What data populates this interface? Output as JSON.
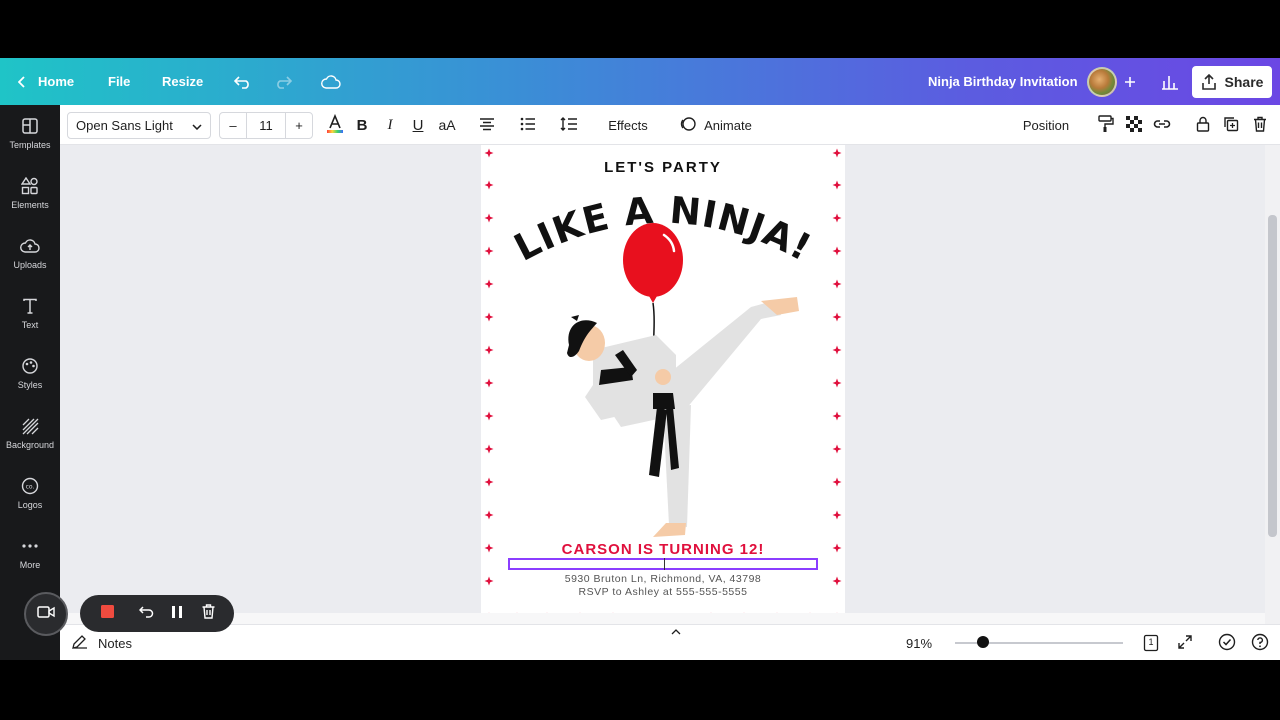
{
  "topbar": {
    "home_label": "Home",
    "file_label": "File",
    "resize_label": "Resize",
    "doc_title": "Ninja Birthday Invitation",
    "share_label": "Share"
  },
  "sidebar": {
    "items": [
      {
        "label": "Templates",
        "icon": "templates-icon"
      },
      {
        "label": "Elements",
        "icon": "elements-icon"
      },
      {
        "label": "Uploads",
        "icon": "uploads-icon"
      },
      {
        "label": "Text",
        "icon": "text-icon"
      },
      {
        "label": "Styles",
        "icon": "styles-icon"
      },
      {
        "label": "Background",
        "icon": "background-icon"
      },
      {
        "label": "Logos",
        "icon": "logos-icon"
      },
      {
        "label": "More",
        "icon": "more-icon"
      }
    ]
  },
  "toolbar": {
    "font_name": "Open Sans Light",
    "font_size": "11",
    "minus": "–",
    "plus": "+",
    "effects_label": "Effects",
    "animate_label": "Animate",
    "position_label": "Position",
    "case_label": "aA"
  },
  "design": {
    "line1": "LET'S PARTY",
    "line2": "LIKE A NINJA!",
    "turning": "CARSON IS TURNING 12!",
    "address": "5930 Bruton Ln, Richmond, VA, 43798",
    "rsvp": "RSVP to Ashley at 555-555-5555",
    "accent_color": "#e0103d",
    "balloon_color": "#e8101e"
  },
  "bottombar": {
    "notes_label": "Notes",
    "zoom": "91%",
    "page_count": "1"
  },
  "colors": {
    "selection": "#8b3dff",
    "sidebar_bg": "#18191b"
  }
}
